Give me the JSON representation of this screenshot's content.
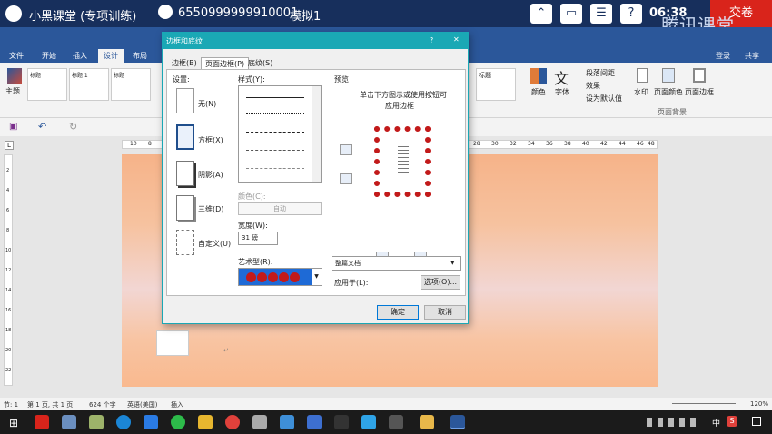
{
  "topbar": {
    "title": "小黑课堂 (专项训练)",
    "user_id": "6550999999910001",
    "mode": "模拟1",
    "time": "06:38",
    "submit": "交卷",
    "brand": "腾讯课堂"
  },
  "menu": [
    "文件",
    "开始",
    "插入",
    "设计",
    "布局"
  ],
  "menu_right": {
    "login": "登录",
    "share": "共享"
  },
  "ribbon": {
    "theme": "主题",
    "style1": "标题",
    "style2": "标题 1",
    "style3": "标题",
    "style4": "标题",
    "colors": "颜色",
    "fonts": "字体",
    "para_spacing": "段落间距",
    "effects": "效果",
    "set_default": "设为默认值",
    "watermark": "水印",
    "page_color": "页面颜色",
    "page_border": "页面边框",
    "group_bg": "页面背景",
    "font_glyph": "文"
  },
  "ruler": {
    "left": [
      "10",
      "8"
    ],
    "right": [
      "28",
      "30",
      "32",
      "34",
      "36",
      "38",
      "40",
      "42",
      "44",
      "46",
      "48"
    ]
  },
  "vruler": [
    "2",
    "4",
    "6",
    "8",
    "10",
    "12",
    "14",
    "16",
    "18",
    "20",
    "22"
  ],
  "dialog": {
    "title": "边框和底纹",
    "help": "?",
    "close": "✕",
    "tabs": [
      "边框(B)",
      "页面边框(P)",
      "底纹(S)"
    ],
    "settings_label": "设置:",
    "settings": [
      "无(N)",
      "方框(X)",
      "阴影(A)",
      "三维(D)",
      "自定义(U)"
    ],
    "style_label": "样式(Y):",
    "color_label": "颜色(C):",
    "color_value": "自动",
    "width_label": "宽度(W):",
    "width_value": "31 磅",
    "art_label": "艺术型(R):",
    "preview_label": "预览",
    "preview_hint1": "单击下方图示或使用按钮可",
    "preview_hint2": "应用边框",
    "apply_label": "应用于(L):",
    "apply_value": "整篇文档",
    "options": "选项(O)...",
    "ok": "确定",
    "cancel": "取消"
  },
  "status": {
    "section": "节: 1",
    "page": "第 1 页, 共 1 页",
    "words": "624 个字",
    "lang": "英语(美国)",
    "insert": "插入",
    "zoom": "120%"
  },
  "taskbar": {
    "ime": "中",
    "ime2": "S"
  },
  "colors": {
    "accent": "#2b579a",
    "dialog": "#1aa8b5",
    "submit": "#d9241b",
    "heart": "#c21a1a"
  }
}
